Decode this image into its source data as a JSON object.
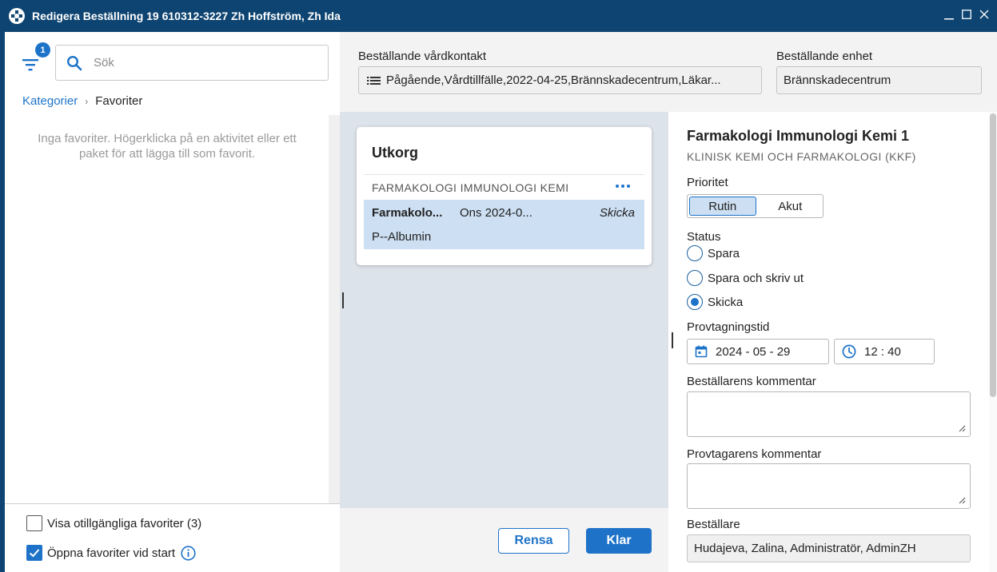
{
  "window": {
    "title": "Redigera Beställning 19 610312-3227 Zh Hoffström, Zh Ida"
  },
  "left_panel": {
    "filter_badge": "1",
    "search_placeholder": "Sök",
    "breadcrumb": {
      "root": "Kategorier",
      "current": "Favoriter"
    },
    "empty_message": "Inga favoriter. Högerklicka på en aktivitet eller ett paket för att lägga till som favorit.",
    "show_unavailable": {
      "label": "Visa otillgängliga favoriter (3)",
      "checked": false
    },
    "open_at_start": {
      "label": "Öppna favoriter vid start",
      "checked": true
    }
  },
  "header": {
    "care_contact_label": "Beställande vårdkontakt",
    "care_contact_value": "Pågående,Vårdtillfälle,2022-04-25,Brännskadecentrum,Läkar...",
    "unit_label": "Beställande enhet",
    "unit_value": "Brännskadecentrum"
  },
  "outbox": {
    "title": "Utkorg",
    "group_header": "FARMAKOLOGI IMMUNOLOGI KEMI",
    "row": {
      "name": "Farmakolo...",
      "date": "Ons 2024-0...",
      "status": "Skicka",
      "sub": "P--Albumin"
    }
  },
  "footer_buttons": {
    "clear": "Rensa",
    "done": "Klar"
  },
  "detail": {
    "title": "Farmakologi Immunologi Kemi 1",
    "subtitle": "KLINISK KEMI OCH FARMAKOLOGI (KKF)",
    "priority_label": "Prioritet",
    "priority_options": [
      "Rutin",
      "Akut"
    ],
    "priority_selected": "Rutin",
    "status_label": "Status",
    "status_options": [
      "Spara",
      "Spara och skriv ut",
      "Skicka"
    ],
    "status_selected": "Skicka",
    "sampling_time_label": "Provtagningstid",
    "sampling_date": "2024 - 05 - 29",
    "sampling_time": "12 : 40",
    "orderer_comment_label": "Beställarens kommentar",
    "orderer_comment": "",
    "sampler_comment_label": "Provtagarens kommentar",
    "sampler_comment": "",
    "orderer_label": "Beställare",
    "orderer_value": "Hudajeva, Zalina, Administratör, AdminZH"
  },
  "colors": {
    "titlebar": "#0e4471",
    "accent": "#1e73c9",
    "selection": "#cddff2",
    "middle_bg": "#dde3ea"
  }
}
